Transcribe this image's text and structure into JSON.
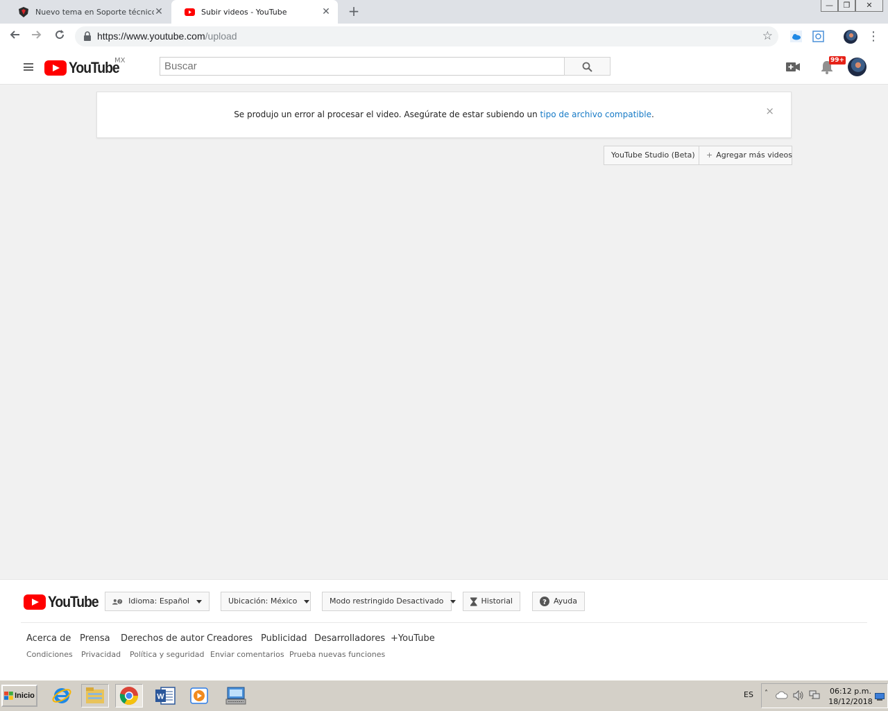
{
  "browser": {
    "tabs": [
      {
        "title": "Nuevo tema en Soporte técnico",
        "close": "✕"
      },
      {
        "title": "Subir videos - YouTube",
        "close": "✕"
      }
    ],
    "new_tab": "+",
    "window_controls": {
      "minimize": "—",
      "restore": "❐",
      "close": "✕"
    },
    "url_host": "https://www.youtube.com",
    "url_path": "/upload"
  },
  "masthead": {
    "logo_text": "YouTube",
    "country_code": "MX",
    "search_placeholder": "Buscar",
    "notification_badge": "99+"
  },
  "error": {
    "message": "Se produjo un error al procesar el video. Asegúrate de estar subiendo un ",
    "link_text": "tipo de archivo compatible",
    "message_end": ".",
    "close": "×"
  },
  "actions": {
    "studio_label": "YouTube Studio (Beta)",
    "add_more_label": "Agregar más videos",
    "add_more_icon": "+"
  },
  "footer": {
    "logo_text": "YouTube",
    "language_btn": "Idioma: Español",
    "location_btn": "Ubicación: México",
    "restricted_btn": "Modo restringido Desactivado",
    "history_btn": "Historial",
    "help_btn": "Ayuda",
    "primary_links": [
      "Acerca de",
      "Prensa",
      "Derechos de autor",
      "Creadores",
      "Publicidad",
      "Desarrolladores",
      "+YouTube"
    ],
    "secondary_links": [
      "Condiciones",
      "Privacidad",
      "Política y seguridad",
      "Enviar comentarios",
      "Prueba nuevas funciones"
    ]
  },
  "taskbar": {
    "start_label": "Inicio",
    "language": "ES",
    "time": "06:12 p.m.",
    "date": "18/12/2018"
  },
  "colors": {
    "youtube_red": "#ff0000",
    "link_blue": "#167ac6",
    "page_bg": "#f1f1f1"
  }
}
